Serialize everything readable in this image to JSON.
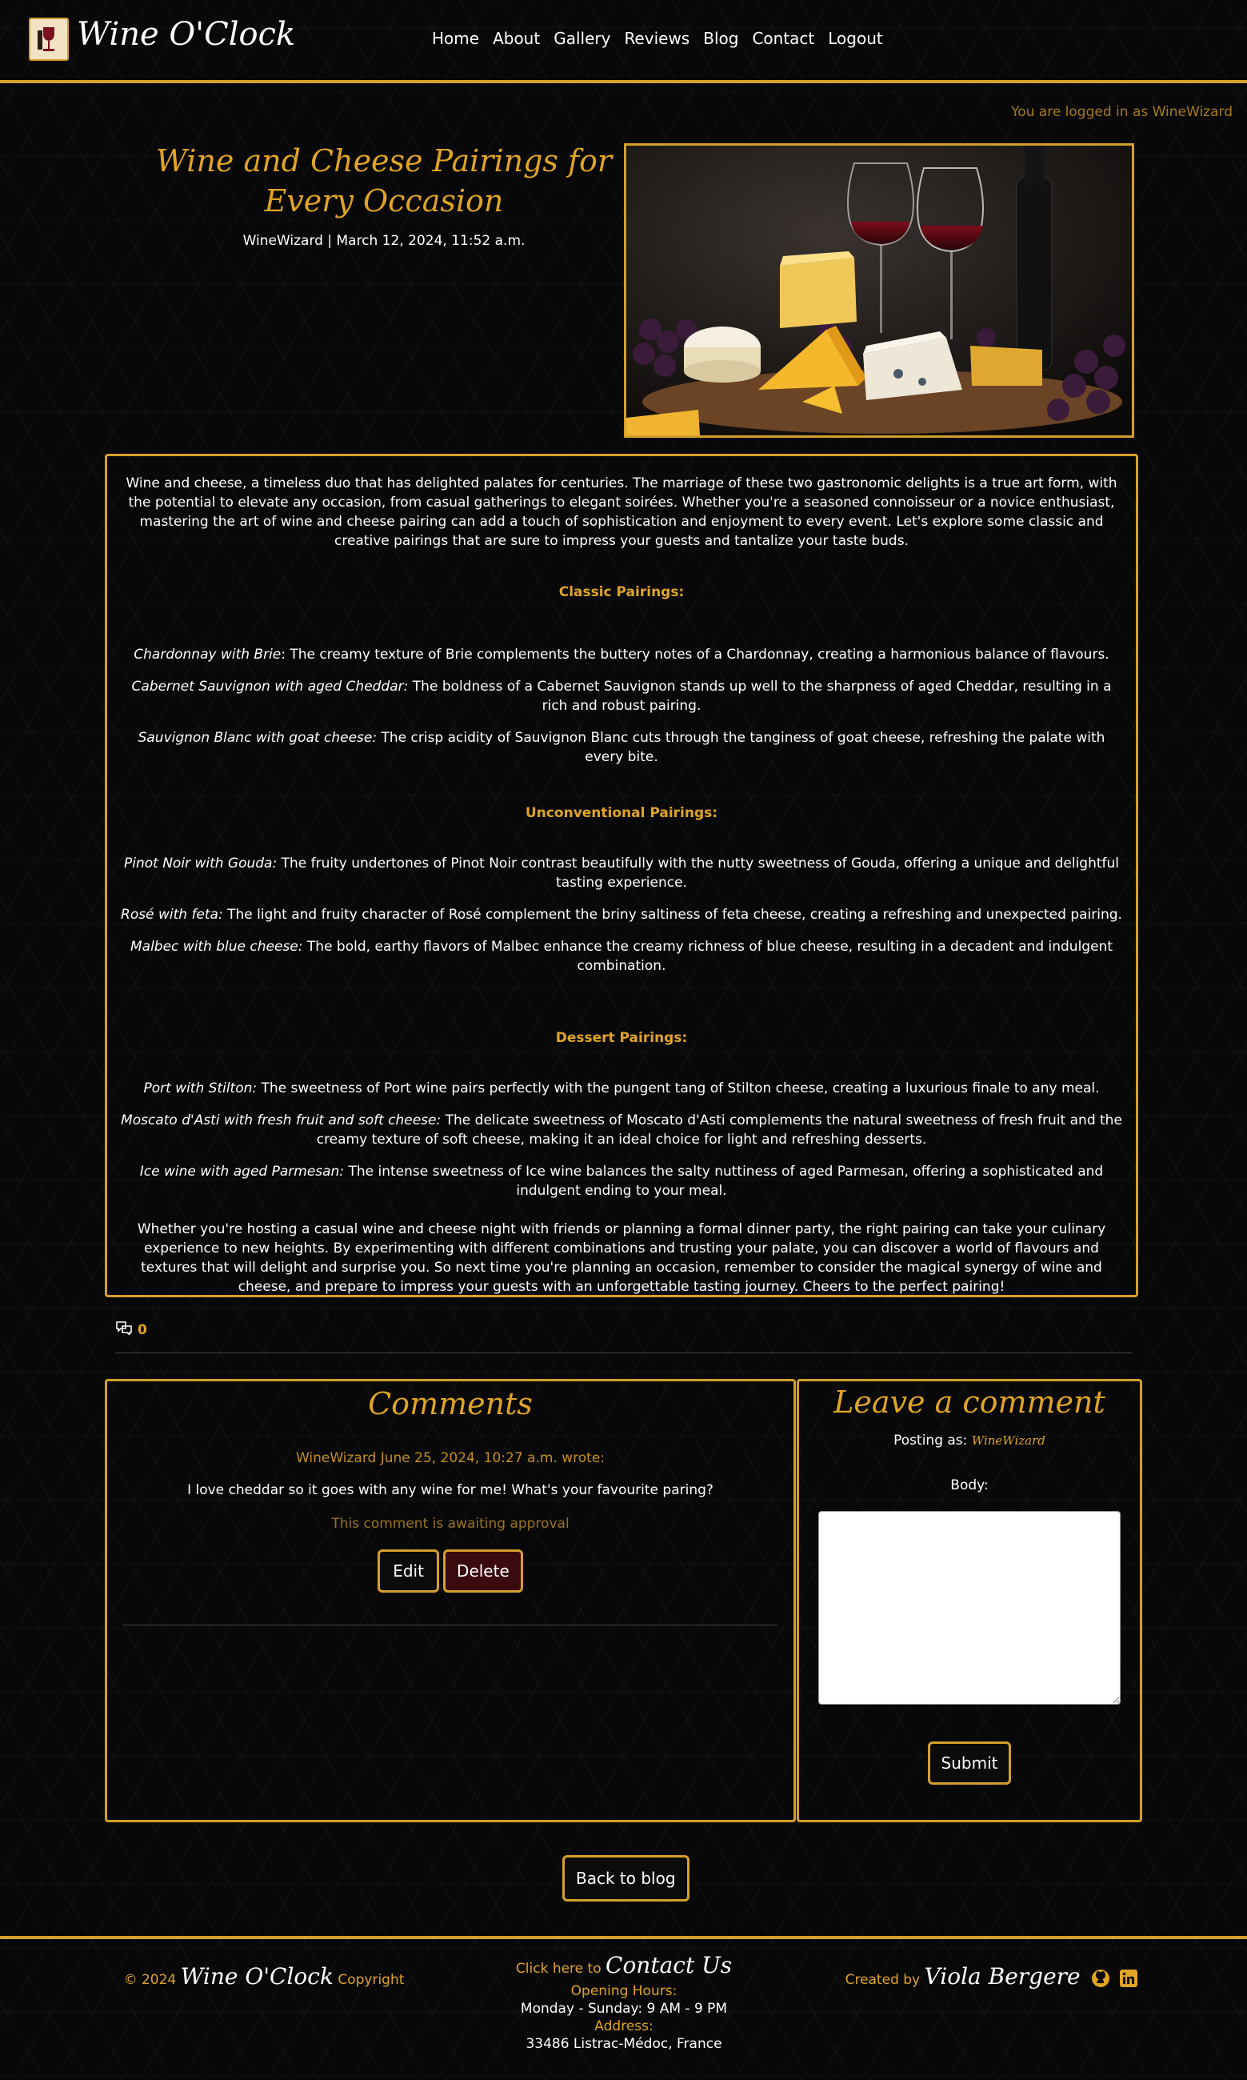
{
  "nav": {
    "brand": "Wine O'Clock",
    "links": [
      "Home",
      "About",
      "Gallery",
      "Reviews",
      "Blog",
      "Contact",
      "Logout"
    ]
  },
  "status": {
    "logged_in": "You are logged in as WineWizard"
  },
  "post": {
    "title": "Wine and Cheese Pairings for Every Occasion",
    "meta": "WineWizard | March 12, 2024, 11:52 a.m.",
    "intro": "Wine and cheese, a timeless duo that has delighted palates for centuries. The marriage of these two gastronomic delights is a true art form, with the potential to elevate any occasion, from casual gatherings to elegant soirées. Whether you're a seasoned connoisseur or a novice enthusiast, mastering the art of wine and cheese pairing can add a touch of sophistication and enjoyment to every event. Let's explore some classic and creative pairings that are sure to impress your guests and tantalize your taste buds.",
    "sections": [
      {
        "heading": "Classic Pairings:",
        "items": [
          {
            "name": "Chardonnay with Brie",
            "text": ": The creamy texture of Brie complements the buttery notes of a Chardonnay, creating a harmonious balance of flavours."
          },
          {
            "name": "Cabernet Sauvignon with aged Cheddar:",
            "text": " The boldness of a Cabernet Sauvignon stands up well to the sharpness of aged Cheddar, resulting in a rich and robust pairing."
          },
          {
            "name": "Sauvignon Blanc with goat cheese:",
            "text": " The crisp acidity of Sauvignon Blanc cuts through the tanginess of goat cheese, refreshing the palate with every bite."
          }
        ]
      },
      {
        "heading": "Unconventional Pairings:",
        "items": [
          {
            "name": "Pinot Noir with Gouda:",
            "text": " The fruity undertones of Pinot Noir contrast beautifully with the nutty sweetness of Gouda, offering a unique and delightful tasting experience."
          },
          {
            "name": "Rosé with feta:",
            "text": " The light and fruity character of Rosé complement the briny saltiness of feta cheese, creating a refreshing and unexpected pairing."
          },
          {
            "name": "Malbec with blue cheese:",
            "text": " The bold, earthy flavors of Malbec enhance the creamy richness of blue cheese, resulting in a decadent and indulgent combination."
          }
        ]
      },
      {
        "heading": "Dessert Pairings:",
        "items": [
          {
            "name": "Port with Stilton:",
            "text": " The sweetness of Port wine pairs perfectly with the pungent tang of Stilton cheese, creating a luxurious finale to any meal."
          },
          {
            "name": "Moscato d'Asti with fresh fruit and soft cheese:",
            "text": " The delicate sweetness of Moscato d'Asti complements the natural sweetness of fresh fruit and the creamy texture of soft cheese, making it an ideal choice for light and refreshing desserts."
          },
          {
            "name": "Ice wine with aged Parmesan:",
            "text": " The intense sweetness of Ice wine balances the salty nuttiness of aged Parmesan, offering a sophisticated and indulgent ending to your meal."
          }
        ]
      }
    ],
    "conclusion": "Whether you're hosting a casual wine and cheese night with friends or planning a formal dinner party, the right pairing can take your culinary experience to new heights. By experimenting with different combinations and trusting your palate, you can discover a world of flavours and textures that will delight and surprise you. So next time you're planning an occasion, remember to consider the magical synergy of wine and cheese, and prepare to impress your guests with an unforgettable tasting journey. Cheers to the perfect pairing!",
    "comment_count": "0"
  },
  "comments": {
    "heading": "Comments",
    "items": [
      {
        "header": "WineWizard June 25, 2024, 10:27 a.m. wrote:",
        "body": "I love cheddar so it goes with any wine for me! What's your favourite paring?",
        "status": "This comment is awaiting approval",
        "edit_label": "Edit",
        "delete_label": "Delete"
      }
    ]
  },
  "leave_comment": {
    "heading": "Leave a comment",
    "posting_as_label": "Posting as:",
    "posting_as_user": "WineWizard",
    "body_label": "Body:",
    "body_value": "",
    "submit_label": "Submit"
  },
  "back_label": "Back to blog",
  "footer": {
    "copyright_prefix": "© 2024",
    "brand": "Wine O'Clock",
    "copyright_suffix": "Copyright",
    "contact_prefix": "Click here to",
    "contact_link": "Contact Us",
    "hours_label": "Opening Hours:",
    "hours_value": "Monday - Sunday: 9 AM - 9 PM",
    "address_label": "Address:",
    "address_value": "33486 Listrac-Médoc, France",
    "created_by": "Created by",
    "author": "Viola Bergere"
  },
  "colors": {
    "accent": "#d4a02a",
    "accent_text": "#e0a426",
    "delete_bg": "#3a0a0f",
    "background": "#080808"
  }
}
